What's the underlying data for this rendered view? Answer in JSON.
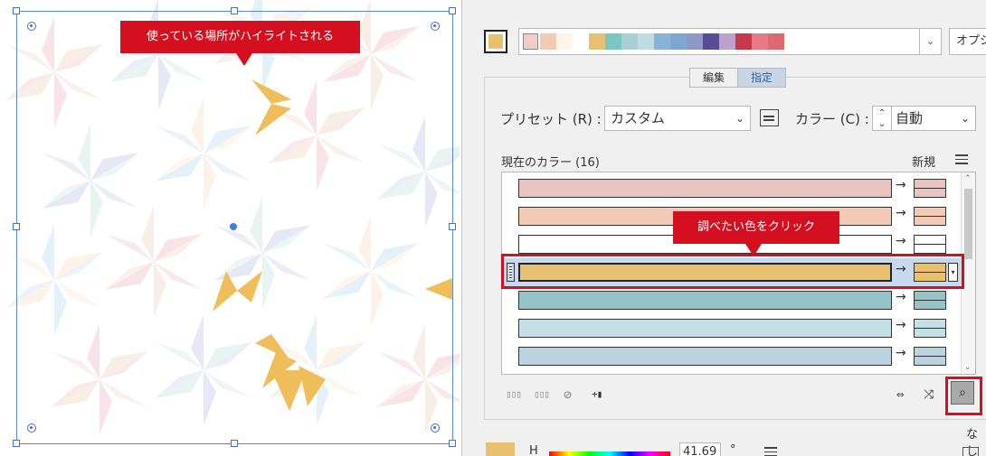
{
  "annotations": {
    "artboard_callout": "使っている場所がハイライトされる",
    "list_callout": "調べたい色をクリック"
  },
  "harmony": {
    "active_color": "#e7c16f",
    "colors": [
      "#f3cbc9",
      "#f2cbb7",
      "#fdf5ea",
      "#ffffff",
      "#e7c16f",
      "#79c6c2",
      "#a8cfd2",
      "#c2dbe3",
      "#86b3d8",
      "#7da6d1",
      "#8e98c5",
      "#5a4b96",
      "#bca1cd",
      "#c9374b",
      "#e67a86",
      "#e06970",
      "#ffffff"
    ],
    "options_label": "オプシ"
  },
  "tabs": {
    "edit": "編集",
    "assign": "指定"
  },
  "preset": {
    "label": "プリセット (R) :",
    "value": "カスタム"
  },
  "color_mode": {
    "label": "カラー (C) :",
    "value": "自動"
  },
  "list": {
    "current_label": "現在のカラー (16)",
    "new_label": "新規",
    "rows": [
      {
        "color": "#e9c4c1"
      },
      {
        "color": "#f0cbb8"
      },
      {
        "color": "#ffffff"
      },
      {
        "color": "#e7c16f"
      },
      {
        "color": "#96c3c5"
      },
      {
        "color": "#c6dfe4"
      },
      {
        "color": "#b9d3e0"
      }
    ],
    "selected_index": 3
  },
  "bottom": {
    "none_label": "なし",
    "swatch_color": "#e7c16f",
    "h_label": "H",
    "h_value": "41.69",
    "h_unit": "°"
  },
  "icons": {
    "tool1": "▯▯▯",
    "tool2": "▯▯▯",
    "tool3": "⊘",
    "tool4": "+▮",
    "tool5": "⇔",
    "tool6": "⤨",
    "find": "⌕"
  }
}
